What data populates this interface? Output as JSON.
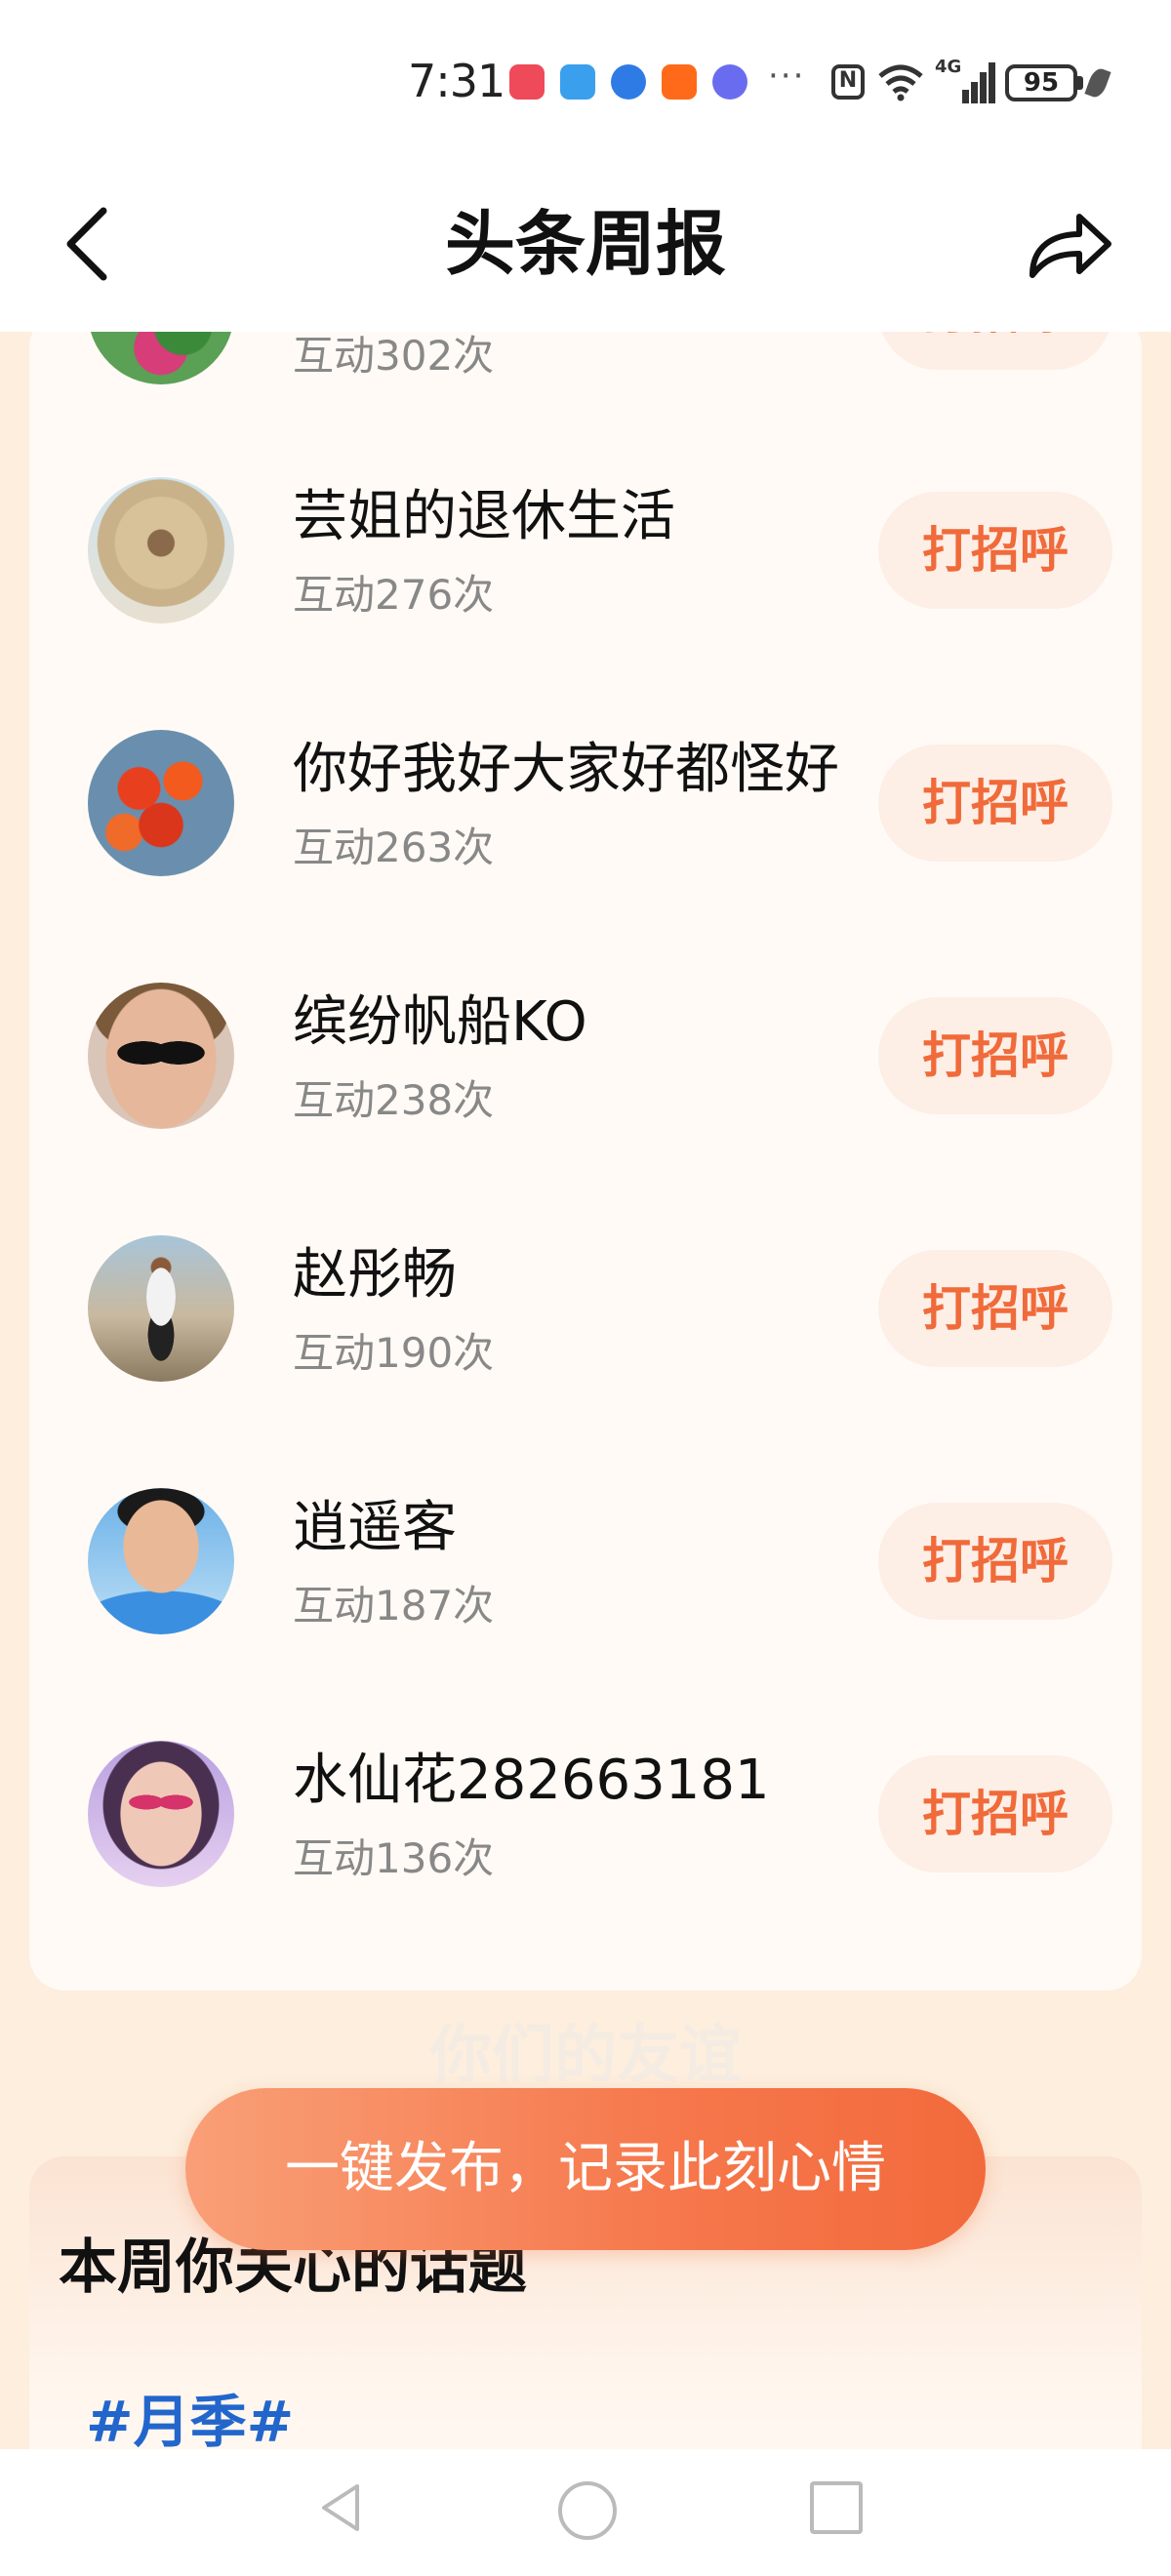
{
  "status_bar": {
    "time": "7:31",
    "battery": "95",
    "network": "4G",
    "more": "···",
    "app_icons": [
      {
        "name": "book-app-icon",
        "color": "#ef4a5a"
      },
      {
        "name": "weather-app-icon",
        "color": "#3aa0ee"
      },
      {
        "name": "browser-app-icon",
        "color": "#2f7be6"
      },
      {
        "name": "grid-app-icon",
        "color": "#ff6a1a"
      },
      {
        "name": "music-app-icon",
        "color": "#6a6cf0"
      }
    ]
  },
  "header": {
    "title": "头条周报",
    "back_icon": "chevron-left-icon",
    "share_icon": "share-arrow-icon"
  },
  "friends": [
    {
      "name": "",
      "count": "互动302次",
      "greet": "打招呼",
      "avatar": "flowers"
    },
    {
      "name": "芸姐的退休生活",
      "count": "互动276次",
      "greet": "打招呼",
      "avatar": "straw-hat"
    },
    {
      "name": "你好我好大家好都怪好",
      "count": "互动263次",
      "greet": "打招呼",
      "avatar": "red-leaves"
    },
    {
      "name": "缤纷帆船KO",
      "count": "互动238次",
      "greet": "打招呼",
      "avatar": "man-sunglasses"
    },
    {
      "name": "赵彤畅",
      "count": "互动190次",
      "greet": "打招呼",
      "avatar": "man-standing"
    },
    {
      "name": "逍遥客",
      "count": "互动187次",
      "greet": "打招呼",
      "avatar": "man-blue-shirt"
    },
    {
      "name": "水仙花282663181",
      "count": "互动136次",
      "greet": "打招呼",
      "avatar": "woman-portrait"
    }
  ],
  "faint_text": "你们的友谊",
  "topics": {
    "title": "本周你关心的话题",
    "tags": [
      "#月季#"
    ]
  },
  "publish_button": "一键发布，记录此刻心情",
  "colors": {
    "accent": "#f26a3c",
    "greet_text": "#f06a3a",
    "greet_bg": "#fdeee6",
    "page_bg": "#fdeedd",
    "card_bg": "#fffaf5",
    "topic_tag": "#2266cc"
  }
}
